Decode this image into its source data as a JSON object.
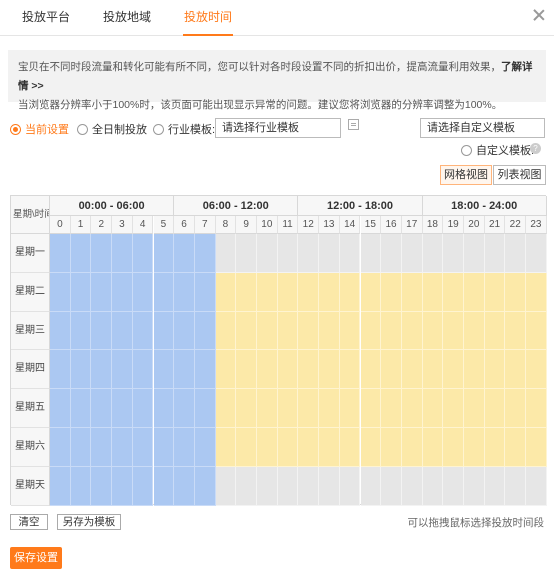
{
  "tabs": [
    {
      "label": "投放平台",
      "active": false
    },
    {
      "label": "投放地域",
      "active": false
    },
    {
      "label": "投放时间",
      "active": true
    }
  ],
  "notice": {
    "line1": "宝贝在不同时段流量和转化可能有所不同，您可以针对各时段设置不同的折扣出价，提高流量利用效果，",
    "link": "了解详情 >>",
    "line2": "当浏览器分辨率小于100%时，该页面可能出现显示异常的问题。建议您将浏览器的分辨率调整为100%。"
  },
  "options": {
    "current": "当前设置",
    "allday": "全日制投放",
    "industry": "行业模板:",
    "industry_placeholder": "请选择行业模板",
    "custom_placeholder": "请选择自定义模板",
    "custom": "自定义模板:",
    "help_icon": "?"
  },
  "views": {
    "grid": "网格视图",
    "list": "列表视图"
  },
  "grid": {
    "corner": "星期\\时间",
    "periods": [
      "00:00 - 06:00",
      "06:00 - 12:00",
      "12:00 - 18:00",
      "18:00 - 24:00"
    ],
    "hours": [
      "0",
      "1",
      "2",
      "3",
      "4",
      "5",
      "6",
      "7",
      "8",
      "9",
      "10",
      "11",
      "12",
      "13",
      "14",
      "15",
      "16",
      "17",
      "18",
      "19",
      "20",
      "21",
      "22",
      "23"
    ],
    "days": [
      "星期一",
      "星期二",
      "星期三",
      "星期四",
      "星期五",
      "星期六",
      "星期天"
    ],
    "legend_colors": {
      "low": "#abc8f2",
      "high": "#fce9a8",
      "off": "#e6e6e6"
    },
    "schedule": [
      [
        "low",
        "low",
        "low",
        "low",
        "low",
        "low",
        "low",
        "low",
        "off",
        "off",
        "off",
        "off",
        "off",
        "off",
        "off",
        "off",
        "off",
        "off",
        "off",
        "off",
        "off",
        "off",
        "off",
        "off"
      ],
      [
        "low",
        "low",
        "low",
        "low",
        "low",
        "low",
        "low",
        "low",
        "high",
        "high",
        "high",
        "high",
        "high",
        "high",
        "high",
        "high",
        "high",
        "high",
        "high",
        "high",
        "high",
        "high",
        "high",
        "high"
      ],
      [
        "low",
        "low",
        "low",
        "low",
        "low",
        "low",
        "low",
        "low",
        "high",
        "high",
        "high",
        "high",
        "high",
        "high",
        "high",
        "high",
        "high",
        "high",
        "high",
        "high",
        "high",
        "high",
        "high",
        "high"
      ],
      [
        "low",
        "low",
        "low",
        "low",
        "low",
        "low",
        "low",
        "low",
        "high",
        "high",
        "high",
        "high",
        "high",
        "high",
        "high",
        "high",
        "high",
        "high",
        "high",
        "high",
        "high",
        "high",
        "high",
        "high"
      ],
      [
        "low",
        "low",
        "low",
        "low",
        "low",
        "low",
        "low",
        "low",
        "high",
        "high",
        "high",
        "high",
        "high",
        "high",
        "high",
        "high",
        "high",
        "high",
        "high",
        "high",
        "high",
        "high",
        "high",
        "high"
      ],
      [
        "low",
        "low",
        "low",
        "low",
        "low",
        "low",
        "low",
        "low",
        "high",
        "high",
        "high",
        "high",
        "high",
        "high",
        "high",
        "high",
        "high",
        "high",
        "high",
        "high",
        "high",
        "high",
        "high",
        "high"
      ],
      [
        "low",
        "low",
        "low",
        "low",
        "low",
        "low",
        "low",
        "low",
        "off",
        "off",
        "off",
        "off",
        "off",
        "off",
        "off",
        "off",
        "off",
        "off",
        "off",
        "off",
        "off",
        "off",
        "off",
        "off"
      ]
    ]
  },
  "footer": {
    "clear": "清空",
    "save_template": "另存为模板",
    "hint": "可以拖拽鼠标选择投放时间段",
    "save": "保存设置"
  },
  "accent": "#ff7a1a"
}
